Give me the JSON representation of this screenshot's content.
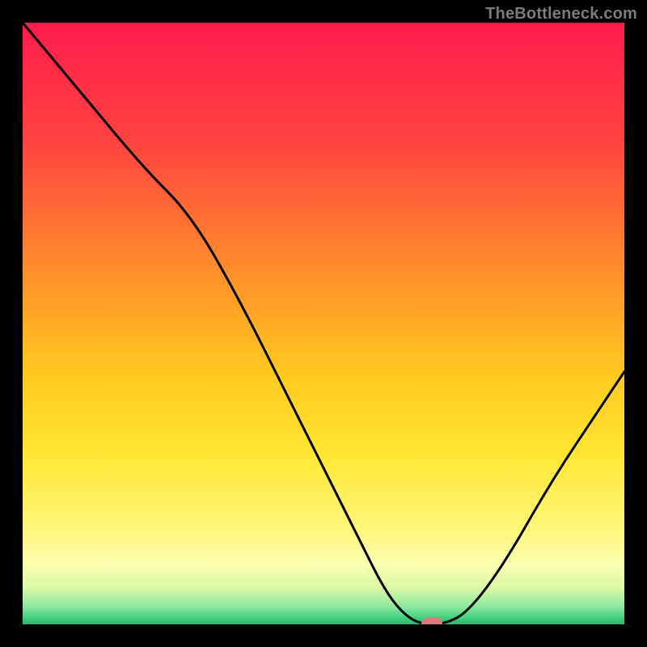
{
  "watermark": "TheBottleneck.com",
  "chart_data": {
    "type": "line",
    "title": "",
    "xlabel": "",
    "ylabel": "",
    "xlim": [
      0,
      100
    ],
    "ylim": [
      0,
      100
    ],
    "grid": false,
    "legend": false,
    "series": [
      {
        "name": "bottleneck-curve",
        "x": [
          0,
          10,
          20,
          28,
          36,
          44,
          50,
          56,
          60,
          63,
          66,
          70,
          74,
          80,
          88,
          96,
          100
        ],
        "y": [
          100,
          88,
          76,
          68,
          54,
          38,
          26,
          14,
          6,
          2,
          0,
          0,
          2,
          10,
          24,
          36,
          42
        ]
      }
    ],
    "marker": {
      "x": 68,
      "y": 0,
      "name": "optimal-point"
    },
    "background_gradient": {
      "stops": [
        {
          "pos": 0.0,
          "color": "#ff1c4b"
        },
        {
          "pos": 0.2,
          "color": "#ff4440"
        },
        {
          "pos": 0.4,
          "color": "#ff8a2b"
        },
        {
          "pos": 0.58,
          "color": "#ffc81f"
        },
        {
          "pos": 0.72,
          "color": "#ffe733"
        },
        {
          "pos": 0.84,
          "color": "#fff67a"
        },
        {
          "pos": 0.9,
          "color": "#fcffb0"
        },
        {
          "pos": 0.94,
          "color": "#d9f9a6"
        },
        {
          "pos": 0.97,
          "color": "#8de9a0"
        },
        {
          "pos": 1.0,
          "color": "#19c06a"
        }
      ]
    }
  }
}
